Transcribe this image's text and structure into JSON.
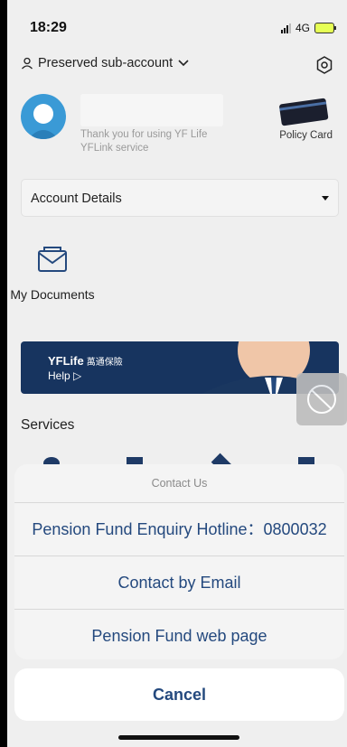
{
  "status": {
    "time": "18:29",
    "network": "4G"
  },
  "header": {
    "account_label": "Preserved sub-account",
    "settings_icon": "gear-icon"
  },
  "profile": {
    "thanks_text": "Thank you for using YF Life YFLink service",
    "policy_card_label": "Policy Card"
  },
  "account_dropdown": {
    "label": "Account Details"
  },
  "shortcuts": {
    "documents_label": "My Documents"
  },
  "banner": {
    "brand": "YFLife",
    "brand_chinese": "萬通保險",
    "help_label": "Help"
  },
  "services": {
    "title": "Services"
  },
  "contact_sheet": {
    "title": "Contact Us",
    "options": [
      "Pension Fund Enquiry Hotline：0800032",
      "Contact by Email",
      "Pension Fund web page"
    ],
    "cancel_label": "Cancel"
  },
  "colors": {
    "accent": "#24497e",
    "banner_bg": "#17345f",
    "avatar": "#3a9ad6"
  }
}
